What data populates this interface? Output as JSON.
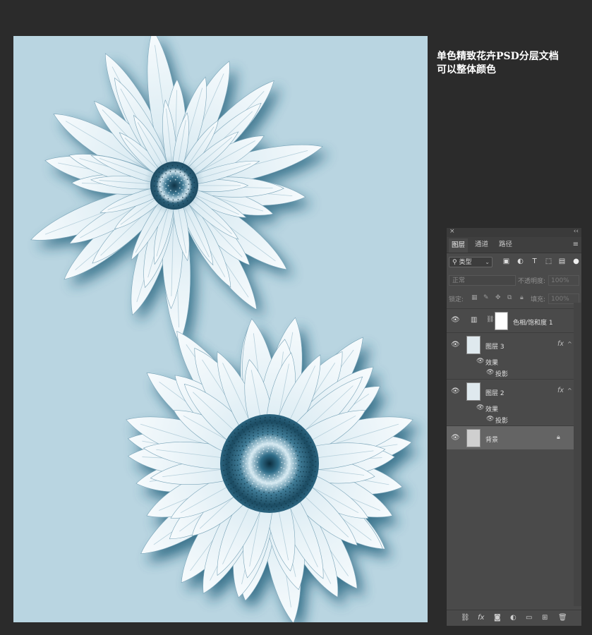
{
  "caption": {
    "line1": "单色精致花卉PSD分层文档",
    "line2": "可以整体颜色"
  },
  "colors": {
    "canvas_bg": "#b9d5e1",
    "petal": "#eef7fb",
    "shadow": "#2e6f8c",
    "center": "#1f5068",
    "panel_bg": "#4a4a4a",
    "app_bg": "#2b2b2b"
  },
  "panel": {
    "close_icon": "×",
    "collapse_icon": "‹‹",
    "tabs": [
      "图层",
      "通道",
      "路径"
    ],
    "menu_icon": "≡",
    "kind_filter": "类型",
    "filter_icons": [
      "image-filter-icon",
      "adjustment-filter-icon",
      "type-filter-icon",
      "shape-filter-icon",
      "smart-object-filter-icon"
    ],
    "blend_mode": "正常",
    "opacity_label": "不透明度:",
    "opacity_value": "100%",
    "lock_label": "锁定:",
    "fill_label": "填充:",
    "fill_value": "100%",
    "layers": [
      {
        "name": "色相/饱和度 1",
        "type": "adjustment"
      },
      {
        "name": "图层 3",
        "type": "pixel",
        "fx": "fx",
        "effects_label": "效果",
        "effect": "投影"
      },
      {
        "name": "图层 2",
        "type": "pixel",
        "fx": "fx",
        "effects_label": "效果",
        "effect": "投影"
      },
      {
        "name": "背景",
        "type": "background",
        "locked": true
      }
    ],
    "bottom_icons": [
      "link-layers-icon",
      "fx-icon",
      "mask-icon",
      "adjustment-icon",
      "group-icon",
      "new-layer-icon",
      "trash-icon"
    ]
  }
}
